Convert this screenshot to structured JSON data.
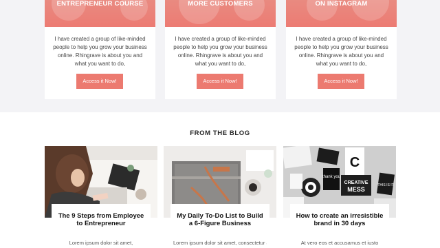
{
  "offers": [
    {
      "banner": "ENTREPRENEUR COURSE",
      "description": "I have created a group of like-minded people to help you grow your business online. Rhingrave is about you and what you want to do,",
      "cta": "Access it Now!"
    },
    {
      "banner": "MORE CUSTOMERS",
      "description": "I have created a group of like-minded people to help you grow your business online. Rhingrave is about you and what you want to do,",
      "cta": "Access it Now!"
    },
    {
      "banner": "ON INSTAGRAM",
      "description": "I have created a group of like-minded people to help you grow your business online. Rhingrave is about you and what you want to do,",
      "cta": "Access it Now!"
    }
  ],
  "blog": {
    "heading": "FROM THE BLOG",
    "posts": [
      {
        "title": "The 9 Steps from Employee to Entrepreneur",
        "excerpt": "Lorem ipsum dolor sit amet,"
      },
      {
        "title": "My Daily To-Do List to Build a 6-Figure Business",
        "excerpt": "Lorem ipsum dolor sit amet, consectetur adipiscing elit. Mauris"
      },
      {
        "title": "How to create an irresistible brand in 30 days",
        "excerpt": "At vero eos et accusamus et iusto"
      }
    ],
    "thumb3_labels": {
      "creative": "CREATIVE",
      "mess": "MESS",
      "this_is_it": "THIS IS IT",
      "thank_you": "thank you",
      "c": "C"
    }
  },
  "colors": {
    "accent": "#ec7a70",
    "page_bg": "#f3f3f6"
  }
}
